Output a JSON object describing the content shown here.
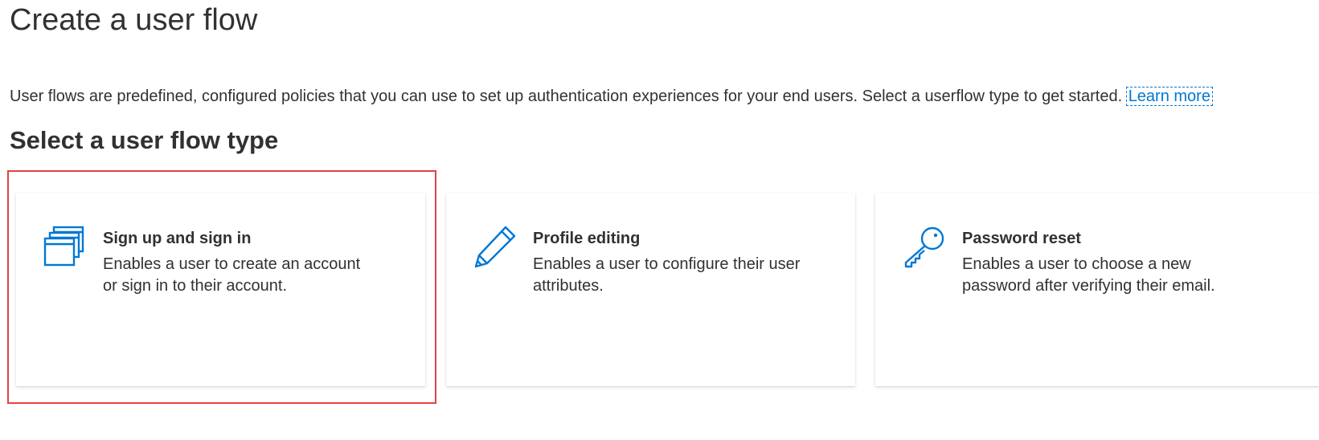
{
  "header": {
    "title": "Create a user flow"
  },
  "intro": {
    "text": "User flows are predefined, configured policies that you can use to set up authentication experiences for your end users. Select a userflow type to get started.",
    "learn_more": "Learn more"
  },
  "section": {
    "title": "Select a user flow type"
  },
  "cards": [
    {
      "icon": "windows-stack-icon",
      "title": "Sign up and sign in",
      "description": "Enables a user to create an account or sign in to their account.",
      "selected": true
    },
    {
      "icon": "pencil-icon",
      "title": "Profile editing",
      "description": "Enables a user to configure their user attributes.",
      "selected": false
    },
    {
      "icon": "key-icon",
      "title": "Password reset",
      "description": "Enables a user to choose a new password after verifying their email.",
      "selected": false
    }
  ],
  "colors": {
    "accent": "#0078d4",
    "highlight": "#e04343",
    "text": "#323130"
  }
}
